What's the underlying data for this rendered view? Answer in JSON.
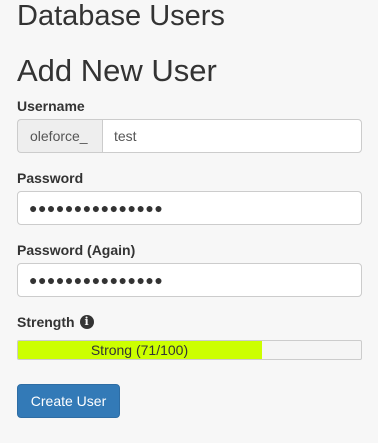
{
  "page": {
    "section_title": "Database Users",
    "form_title": "Add New User"
  },
  "username": {
    "label": "Username",
    "prefix": "oleforce_",
    "value": "test"
  },
  "password": {
    "label": "Password",
    "masked_value": "●●●●●●●●●●●●●●●"
  },
  "password_again": {
    "label": "Password (Again)",
    "masked_value": "●●●●●●●●●●●●●●●"
  },
  "strength": {
    "label": "Strength",
    "icon": "info-circle-icon",
    "text": "Strong (71/100)",
    "score": 71,
    "max": 100,
    "fill_fraction": 0.71,
    "fill_color": "#ccff00"
  },
  "actions": {
    "create_label": "Create User",
    "button_color": "#337ab7"
  }
}
